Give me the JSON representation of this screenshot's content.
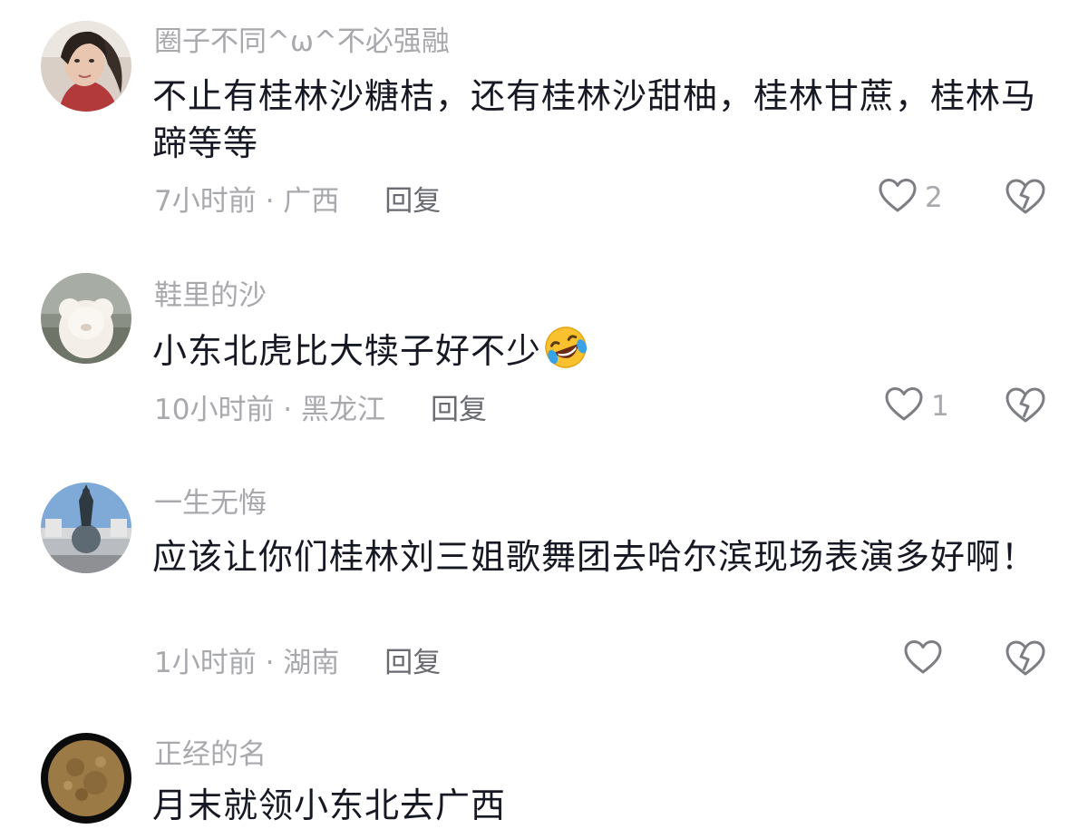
{
  "comments": [
    {
      "username": "圈子不同^ω^不必强融",
      "text": "不止有桂林沙糖桔，还有桂林沙甜柚，桂林甘蔗，桂林马蹄等等",
      "time_location": "7小时前 · 广西",
      "reply_label": "回复",
      "like_count": "2",
      "avatar": "avatar-woman-portrait"
    },
    {
      "username": "鞋里的沙",
      "text": "小东北虎比大犊子好不少",
      "emoji": "rolling-laughing-emoji",
      "time_location": "10小时前 · 黑龙江",
      "reply_label": "回复",
      "like_count": "1",
      "avatar": "avatar-white-fluffy-toy"
    },
    {
      "username": "一生无悔",
      "text": "应该让你们桂林刘三姐歌舞团去哈尔滨现场表演多好啊！",
      "time_location": "1小时前 · 湖南",
      "reply_label": "回复",
      "like_count": "",
      "avatar": "avatar-globe-statue"
    },
    {
      "username": "正经的名",
      "text": "月末就领小东北去广西",
      "avatar": "avatar-moon"
    }
  ],
  "colors": {
    "username": "#a8a9ad",
    "text": "#161823",
    "meta": "#a8a9ad",
    "reply": "#6a6b70",
    "icon": "#7d7e83"
  }
}
